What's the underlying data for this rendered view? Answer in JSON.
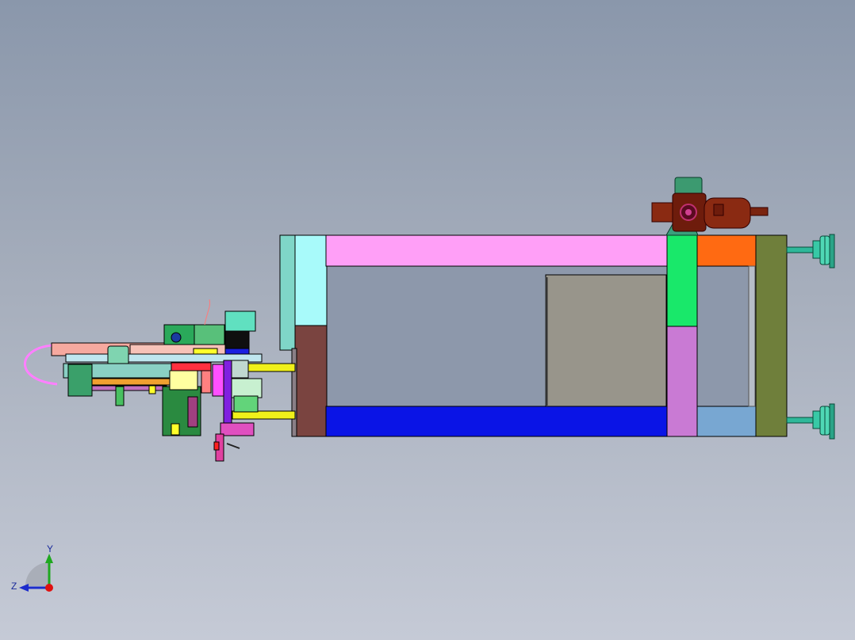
{
  "viewport": {
    "background_top": "#8a97ab",
    "background_bottom": "#c5cad6"
  },
  "triad": {
    "y_label": "Y",
    "z_label": "Z",
    "y_color": "#1fa81f",
    "z_color": "#1c2ccc",
    "x_color": "#e01010"
  },
  "colors": {
    "pink_beam": "#ff9ff7",
    "cyan_block": "#a8fafa",
    "brown_block": "#7a4440",
    "blue_beam": "#0a14e6",
    "green_block": "#19e86a",
    "orchid_block": "#c97ad4",
    "orange_block": "#ff6a12",
    "steel_blue_block": "#78a7d2",
    "olive_plate": "#6f7f3b",
    "gray_plate": "#98958b",
    "yellow_rod": "#f0f01a",
    "teal_cylinder": "#2fb89a",
    "rust_motor": "#8a2a12"
  },
  "icons": {
    "motor": "motor-icon",
    "cylinder_end": "cylinder-end-icon",
    "axis_triad": "axis-triad-icon"
  }
}
